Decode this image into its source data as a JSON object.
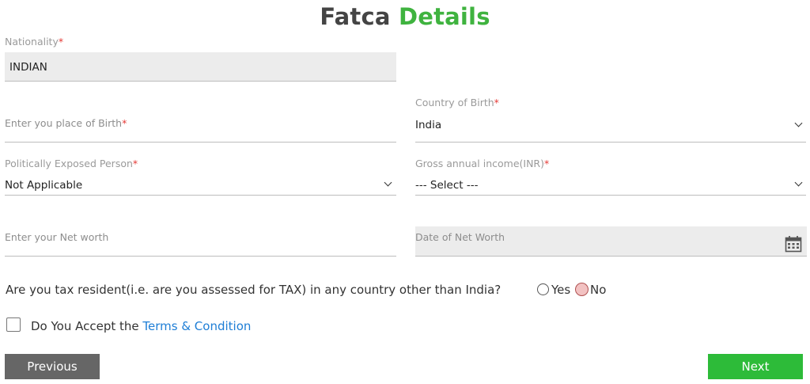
{
  "header": {
    "title_part1": "Fatca",
    "title_part2": "Details"
  },
  "fields": {
    "nationality": {
      "label": "Nationality",
      "required": "*",
      "value": "INDIAN"
    },
    "place_of_birth": {
      "placeholder": "Enter you place of Birth",
      "required": "*"
    },
    "country_of_birth": {
      "label": "Country of Birth",
      "required": "*",
      "value": "India"
    },
    "pep": {
      "label": "Politically Exposed Person",
      "required": "*",
      "value": "Not Applicable"
    },
    "gross_income": {
      "label": "Gross annual income(INR)",
      "required": "*",
      "value": "--- Select ---"
    },
    "net_worth": {
      "placeholder": "Enter your Net worth"
    },
    "date_net_worth": {
      "placeholder": "Date of Net Worth"
    }
  },
  "tax_question": {
    "text": "Are you tax resident(i.e. are you assessed for TAX) in any country other than India?",
    "options": [
      "Yes",
      "No"
    ],
    "selected": "No"
  },
  "terms": {
    "prefix": "Do You Accept the ",
    "link": "Terms & Condition",
    "checked": false
  },
  "buttons": {
    "previous": "Previous",
    "next": "Next"
  },
  "colors": {
    "accent_green": "#3fb33f",
    "link_blue": "#1e7ed6",
    "button_gray": "#666666",
    "button_green": "#2dbb39",
    "required_red": "#e53935"
  }
}
